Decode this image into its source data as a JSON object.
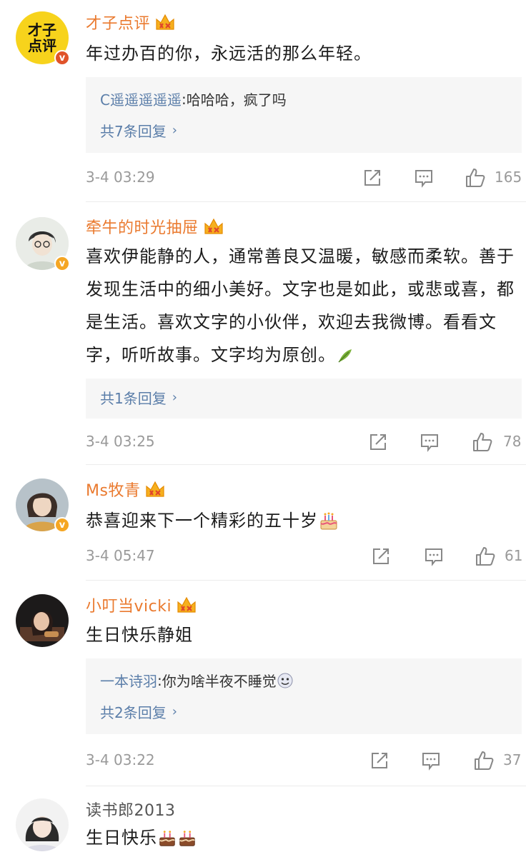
{
  "comments": [
    {
      "username": "才子点评",
      "avatar_text": "才子\n点评",
      "text": "年过办百的你，永远活的那么年轻。",
      "reply": {
        "user": "C遥遥遥遥遥",
        "sep": ":",
        "text": " 哈哈哈，疯了吗"
      },
      "more": "共7条回复",
      "time": "3-4 03:29",
      "likes": "165"
    },
    {
      "username": "牵牛的时光抽屉",
      "text": "喜欢伊能静的人，通常善良又温暖，敏感而柔软。善于发现生活中的细小美好。文字也是如此，或悲或喜，都是生活。喜欢文字的小伙伴，欢迎去我微博。看看文字，听听故事。文字均为原创。",
      "more": "共1条回复",
      "time": "3-4 03:25",
      "likes": "78"
    },
    {
      "username": "Ms牧青",
      "text": "恭喜迎来下一个精彩的五十岁",
      "time": "3-4 05:47",
      "likes": "61"
    },
    {
      "username": "小叮当vicki",
      "text": "生日快乐静姐",
      "reply": {
        "user": "一本诗羽",
        "sep": ":",
        "text": " 你为啥半夜不睡觉"
      },
      "more": "共2条回复",
      "time": "3-4 03:22",
      "likes": "37"
    },
    {
      "username": "读书郎2013",
      "text": "生日快乐"
    }
  ],
  "colors": {
    "username": "#ea7a2f",
    "reply_link": "#5b7ea9",
    "badge": "#f5a623"
  }
}
